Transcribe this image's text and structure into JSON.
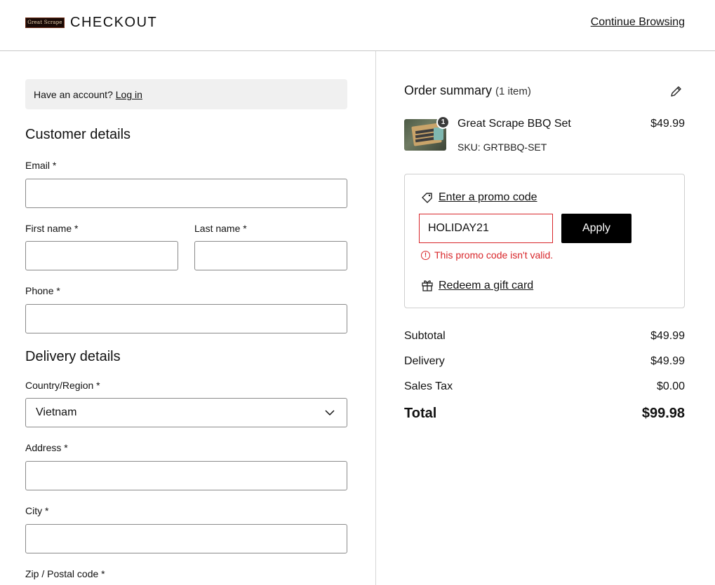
{
  "header": {
    "logo_text": "Great Scrape",
    "title": "CHECKOUT",
    "continue_link": "Continue Browsing"
  },
  "account": {
    "prompt": "Have an account?",
    "login_link": "Log in"
  },
  "customer_details": {
    "heading": "Customer details",
    "email_label": "Email *",
    "email_value": "",
    "first_name_label": "First name *",
    "first_name_value": "",
    "last_name_label": "Last name *",
    "last_name_value": "",
    "phone_label": "Phone *",
    "phone_value": ""
  },
  "delivery_details": {
    "heading": "Delivery details",
    "country_label": "Country/Region *",
    "country_value": "Vietnam",
    "address_label": "Address *",
    "address_value": "",
    "city_label": "City *",
    "city_value": "",
    "zip_label": "Zip / Postal code *"
  },
  "order_summary": {
    "heading": "Order summary",
    "item_count": "(1 item)",
    "item": {
      "quantity": "1",
      "name": "Great Scrape BBQ Set",
      "sku": "SKU: GRTBBQ-SET",
      "price": "$49.99"
    },
    "promo": {
      "link": "Enter a promo code",
      "input_value": "HOLIDAY21",
      "apply_label": "Apply",
      "error": "This promo code isn't valid.",
      "gift_link": "Redeem a gift card"
    },
    "totals": {
      "subtotal_label": "Subtotal",
      "subtotal_value": "$49.99",
      "delivery_label": "Delivery",
      "delivery_value": "$49.99",
      "tax_label": "Sales Tax",
      "tax_value": "$0.00",
      "total_label": "Total",
      "total_value": "$99.98"
    }
  },
  "colors": {
    "error": "#d8262a",
    "button_bg": "#000000",
    "account_box_bg": "#f0f0f0"
  },
  "icons": [
    "edit-icon",
    "tag-icon",
    "error-icon",
    "gift-icon",
    "chevron-down-icon"
  ]
}
